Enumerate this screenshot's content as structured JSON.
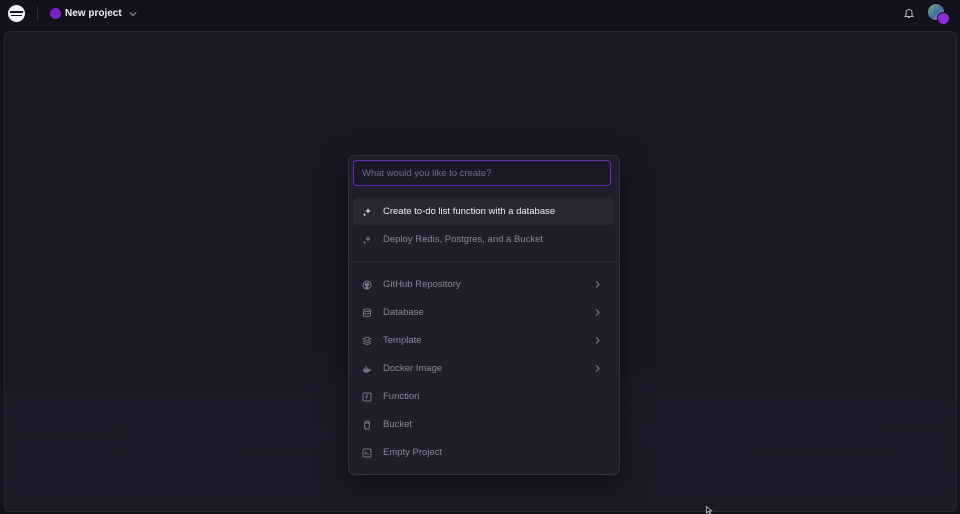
{
  "topbar": {
    "project_name": "New project",
    "project_color": "#7b1fbf",
    "icons": [
      "railway-logo-icon",
      "chevron-down-icon",
      "bell-icon",
      "avatar"
    ]
  },
  "composer": {
    "placeholder": "What would you like to create?",
    "suggestions": [
      {
        "label": "Create to-do list function with a database",
        "icon": "sparkle-icon",
        "active": true
      },
      {
        "label": "Deploy Redis, Postgres, and a Bucket",
        "icon": "sparkle-icon",
        "active": false
      }
    ],
    "options": [
      {
        "label": "GitHub Repository",
        "icon": "github-icon",
        "has_submenu": true
      },
      {
        "label": "Database",
        "icon": "database-icon",
        "has_submenu": true
      },
      {
        "label": "Template",
        "icon": "layers-icon",
        "has_submenu": true
      },
      {
        "label": "Docker Image",
        "icon": "docker-icon",
        "has_submenu": true
      },
      {
        "label": "Function",
        "icon": "function-icon",
        "has_submenu": false
      },
      {
        "label": "Bucket",
        "icon": "bucket-icon",
        "has_submenu": false
      },
      {
        "label": "Empty Project",
        "icon": "terminal-icon",
        "has_submenu": false
      }
    ],
    "accent_color": "#6a2fb0"
  }
}
